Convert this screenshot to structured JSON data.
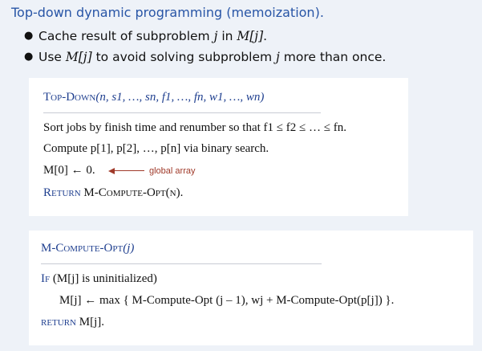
{
  "title": "Top-down dynamic programming (memoization).",
  "bullets": [
    {
      "a": "Cache result of subproblem ",
      "b": "j",
      "c": " in ",
      "d": "M[j]",
      "e": "."
    },
    {
      "a": "Use ",
      "b": "M[j]",
      "c": " to avoid solving subproblem ",
      "d": "j",
      "e": " more than once."
    }
  ],
  "top_down": {
    "header": "Top-Down",
    "params": "(n, s1, …, sn, f1, …, fn, w1, …, wn)",
    "line1": "Sort jobs by finish time and renumber so that f1 ≤ f2 ≤ … ≤ fn.",
    "line2": "Compute p[1], p[2], …, p[n] via binary search.",
    "line3": "M[0] ← 0.",
    "annotation": "global array",
    "line4_kw": "Return",
    "line4_rest": "M-Compute-Opt(n)."
  },
  "mco": {
    "header": "M-Compute-Opt",
    "params": "(j)",
    "if_kw": "If",
    "if_rest": "(M[j] is uninitialized)",
    "assign": "M[j] ← max { M-Compute-Opt (j – 1), wj + M-Compute-Opt(p[j]) }.",
    "return_kw": "return",
    "return_rest": "M[j]."
  }
}
